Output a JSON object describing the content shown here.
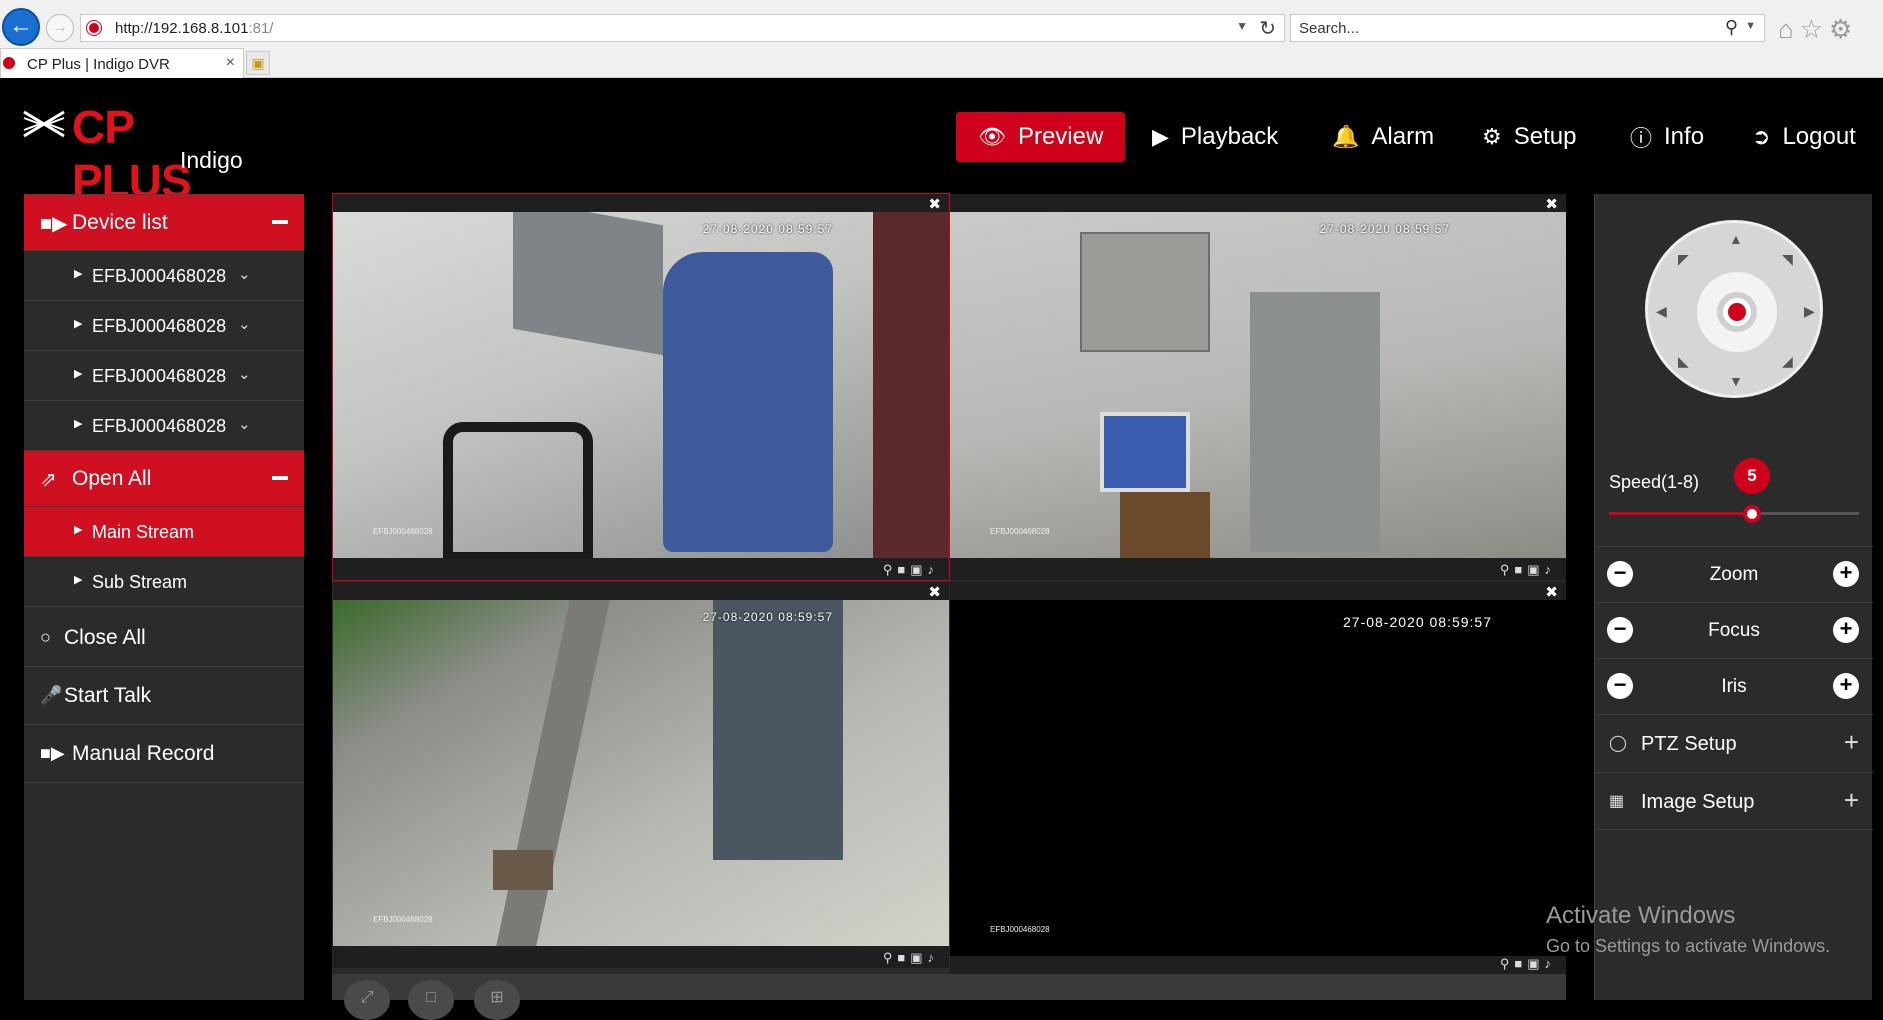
{
  "browser": {
    "url_host": "http://192.168.8.101",
    "url_port": ":81/",
    "search_placeholder": "Search...",
    "tab_title": "CP Plus | Indigo DVR",
    "tab_close": "×"
  },
  "logo": {
    "brand": "CP PLUS",
    "sub": "Indigo"
  },
  "topnav": {
    "preview": "Preview",
    "playback": "Playback",
    "alarm": "Alarm",
    "setup": "Setup",
    "info": "Info",
    "logout": "Logout"
  },
  "sidebar": {
    "device_list": "Device list",
    "devices": [
      "EFBJ000468028",
      "EFBJ000468028",
      "EFBJ000468028",
      "EFBJ000468028"
    ],
    "open_all": "Open All",
    "main_stream": "Main Stream",
    "sub_stream": "Sub Stream",
    "close_all": "Close All",
    "start_talk": "Start Talk",
    "manual_record": "Manual Record"
  },
  "video": {
    "cells": [
      {
        "timestamp": "27-08-2020 08:59:57",
        "id": "EFBJ000468028",
        "selected": true
      },
      {
        "timestamp": "27-08-2020 08:59:57",
        "id": "EFBJ000468028",
        "selected": false
      },
      {
        "timestamp": "27-08-2020 08:59:57",
        "id": "EFBJ000468028",
        "selected": false
      },
      {
        "timestamp": "27-08-2020 08:59:57",
        "id": "EFBJ000468028",
        "selected": false
      }
    ]
  },
  "ptz": {
    "speed_label": "Speed(1-8)",
    "speed_value": "5",
    "speed_min": 1,
    "speed_max": 8,
    "zoom": "Zoom",
    "focus": "Focus",
    "iris": "Iris",
    "ptz_setup": "PTZ Setup",
    "image_setup": "Image Setup"
  },
  "watermark": {
    "title": "Activate Windows",
    "subtitle": "Go to Settings to activate Windows."
  },
  "colors": {
    "accent": "#d0021b",
    "panel": "#2b2b2b",
    "background": "#000000"
  }
}
